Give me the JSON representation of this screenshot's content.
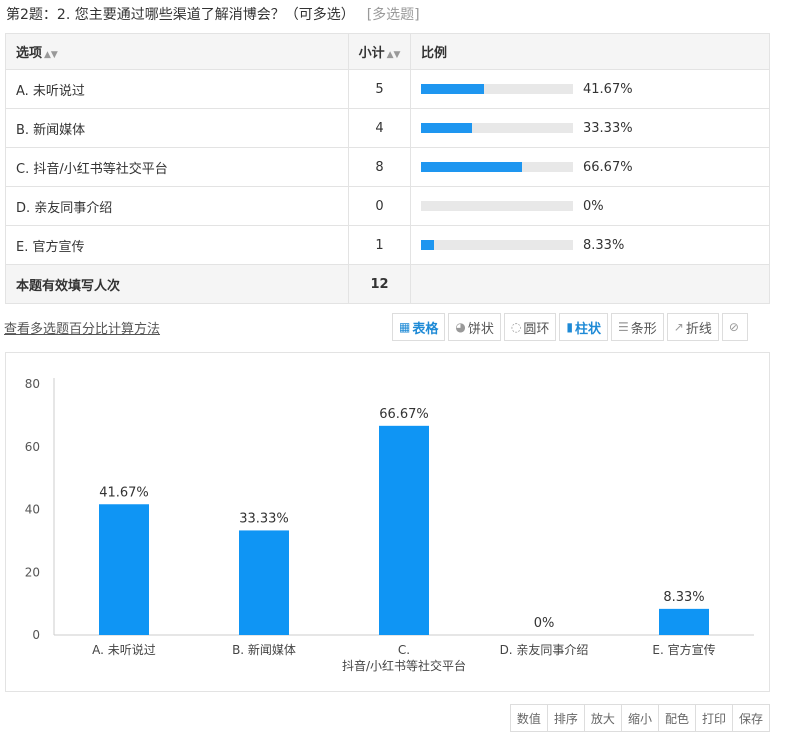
{
  "question": {
    "title": "第2题：2. 您主要通过哪些渠道了解消博会？（可多选）",
    "type_tag": "[多选题]"
  },
  "table": {
    "headers": [
      "选项",
      "小计",
      "比例"
    ],
    "sort_icon": "sort-updown-icon",
    "rows": [
      {
        "label": "A. 未听说过",
        "count": "5",
        "pct": "41.67%",
        "ratio": 0.4167
      },
      {
        "label": "B. 新闻媒体",
        "count": "4",
        "pct": "33.33%",
        "ratio": 0.3333
      },
      {
        "label": "C. 抖音/小红书等社交平台",
        "count": "8",
        "pct": "66.67%",
        "ratio": 0.6667
      },
      {
        "label": "D. 亲友同事介绍",
        "count": "0",
        "pct": "0%",
        "ratio": 0
      },
      {
        "label": "E. 官方宣传",
        "count": "1",
        "pct": "8.33%",
        "ratio": 0.0833
      }
    ],
    "total_label": "本题有效填写人次",
    "total_count": "12"
  },
  "calc_link": "查看多选题百分比计算方法",
  "view_tabs": [
    {
      "label": "表格",
      "icon": "table-icon",
      "active": true
    },
    {
      "label": "饼状",
      "icon": "pie-icon",
      "active": false
    },
    {
      "label": "圆环",
      "icon": "ring-icon",
      "active": false
    },
    {
      "label": "柱状",
      "icon": "bar-chart-icon",
      "active": true
    },
    {
      "label": "条形",
      "icon": "hbar-icon",
      "active": false
    },
    {
      "label": "折线",
      "icon": "line-chart-icon",
      "active": false
    },
    {
      "label": "",
      "icon": "disable-icon",
      "active": false
    }
  ],
  "chart_data": {
    "type": "bar",
    "categories": [
      "A. 未听说过",
      "B. 新闻媒体",
      "C. 抖音/小红书等社交平台",
      "D. 亲友同事介绍",
      "E. 官方宣传"
    ],
    "category_lines": [
      [
        "A. 未听说过"
      ],
      [
        "B. 新闻媒体"
      ],
      [
        "C.",
        "抖音/小红书等社交平台"
      ],
      [
        "D. 亲友同事介绍"
      ],
      [
        "E. 官方宣传"
      ]
    ],
    "values": [
      41.67,
      33.33,
      66.67,
      0,
      8.33
    ],
    "data_labels": [
      "41.67%",
      "33.33%",
      "66.67%",
      "0%",
      "8.33%"
    ],
    "yticks": [
      0,
      20,
      40,
      60,
      80
    ],
    "ylim": [
      0,
      80
    ],
    "color": "#0f95f4",
    "grid": false
  },
  "tools": [
    "数值",
    "排序",
    "放大",
    "缩小",
    "配色",
    "打印",
    "保存"
  ]
}
